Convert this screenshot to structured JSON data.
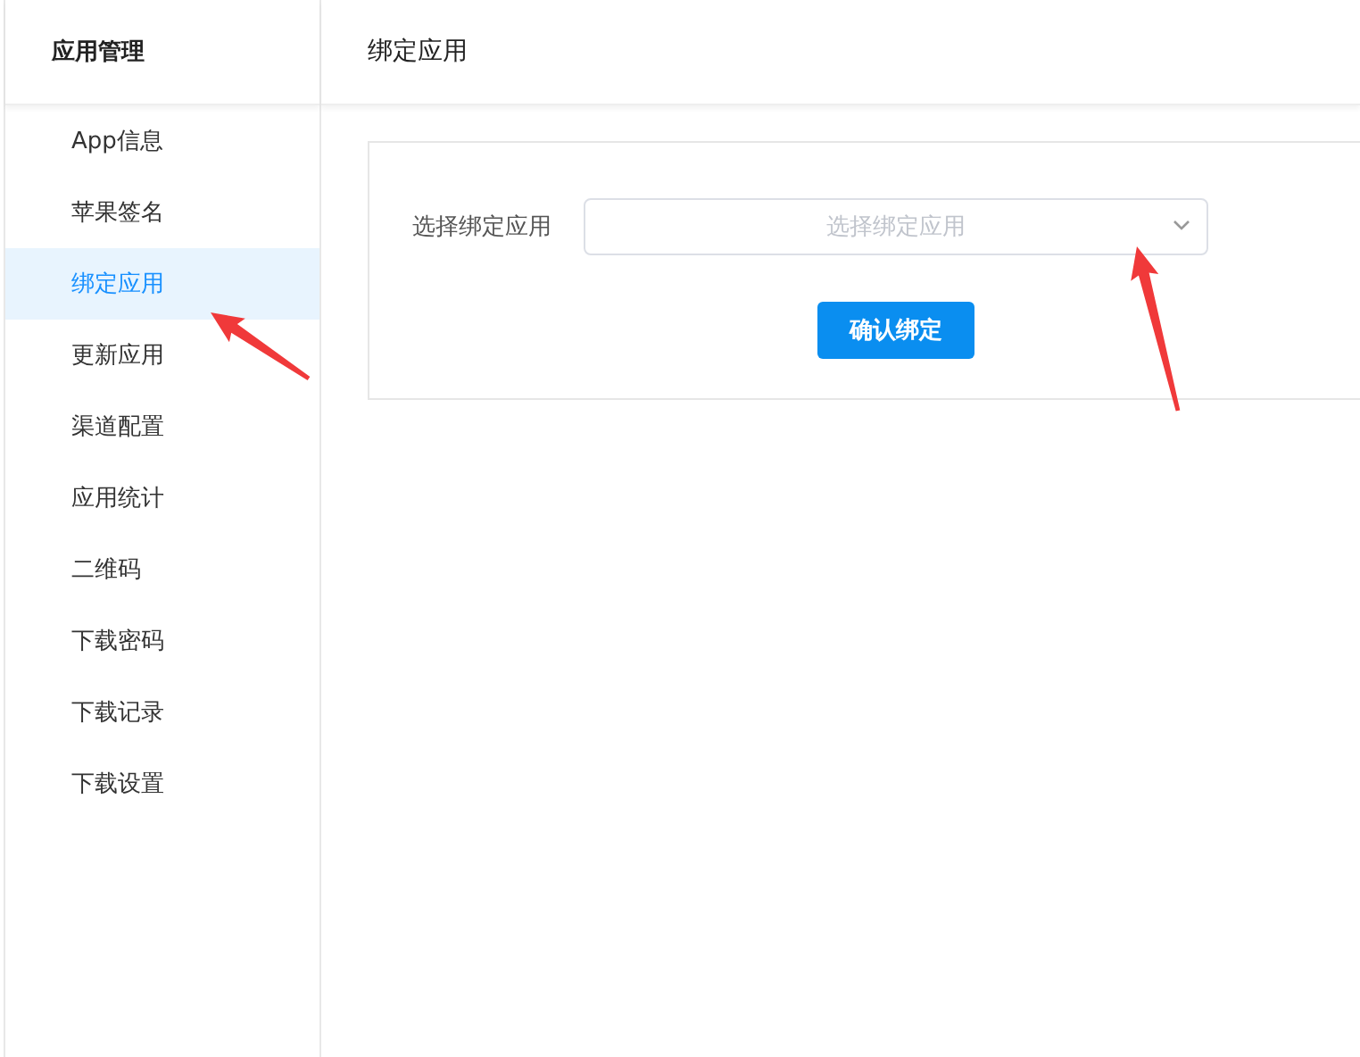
{
  "sidebar": {
    "title": "应用管理",
    "items": [
      {
        "label": "App信息",
        "selected": false
      },
      {
        "label": "苹果签名",
        "selected": false
      },
      {
        "label": "绑定应用",
        "selected": true
      },
      {
        "label": "更新应用",
        "selected": false
      },
      {
        "label": "渠道配置",
        "selected": false
      },
      {
        "label": "应用统计",
        "selected": false
      },
      {
        "label": "二维码",
        "selected": false
      },
      {
        "label": "下载密码",
        "selected": false
      },
      {
        "label": "下载记录",
        "selected": false
      },
      {
        "label": "下载设置",
        "selected": false
      }
    ]
  },
  "main": {
    "title": "绑定应用",
    "form": {
      "label": "选择绑定应用",
      "select": {
        "placeholder": "选择绑定应用"
      },
      "button": "确认绑定"
    }
  }
}
